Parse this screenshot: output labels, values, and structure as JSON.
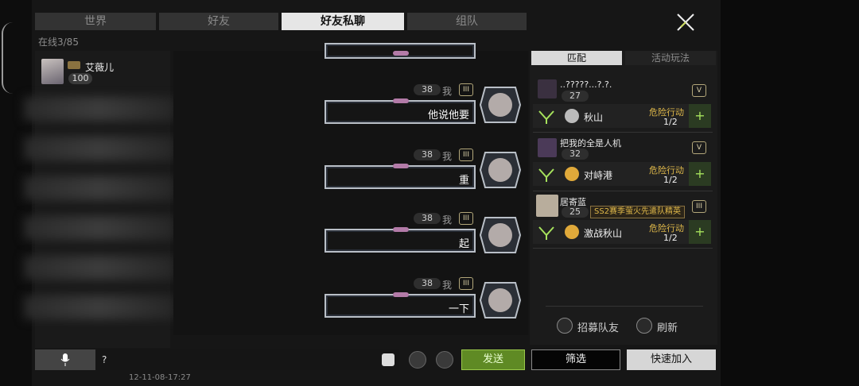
{
  "tabs": [
    {
      "label": "世界",
      "active": false
    },
    {
      "label": "好友",
      "active": false
    },
    {
      "label": "好友私聊",
      "active": true
    },
    {
      "label": "组队",
      "active": false
    }
  ],
  "online": "在线3/85",
  "selected_friend": {
    "name": "艾薇儿",
    "level": "100"
  },
  "messages": [
    {
      "level": "38",
      "sender": "我",
      "rank": "III",
      "text": "他说他要"
    },
    {
      "level": "38",
      "sender": "我",
      "rank": "III",
      "text": "重"
    },
    {
      "level": "38",
      "sender": "我",
      "rank": "III",
      "text": "起"
    },
    {
      "level": "38",
      "sender": "我",
      "rank": "III",
      "text": "一下"
    }
  ],
  "right_tabs": {
    "match": "匹配",
    "activities": "活动玩法"
  },
  "teams": [
    {
      "captain": "..?????...?.?.",
      "level": "27",
      "rank": "V",
      "map": "秋山",
      "mode": "危险行动",
      "count": "1/2",
      "title": ""
    },
    {
      "captain": "把我的全是人机",
      "level": "32",
      "rank": "V",
      "map": "对峙港",
      "mode": "危险行动",
      "count": "1/2",
      "title": ""
    },
    {
      "captain": "居寄蓝",
      "level": "25",
      "rank": "III",
      "map": "激战秋山",
      "mode": "危险行动",
      "count": "1/2",
      "title": "SS2赛季萤火先遣队精英"
    }
  ],
  "recruit_label": "招募队友",
  "refresh_label": "刷新",
  "input_value": "?",
  "send_label": "发送",
  "filter_label": "筛选",
  "join_label": "快速加入",
  "timestamp": "12-11-08-17:27",
  "colors": {
    "accent_green": "#a6e25c",
    "gold": "#e0b94a"
  }
}
